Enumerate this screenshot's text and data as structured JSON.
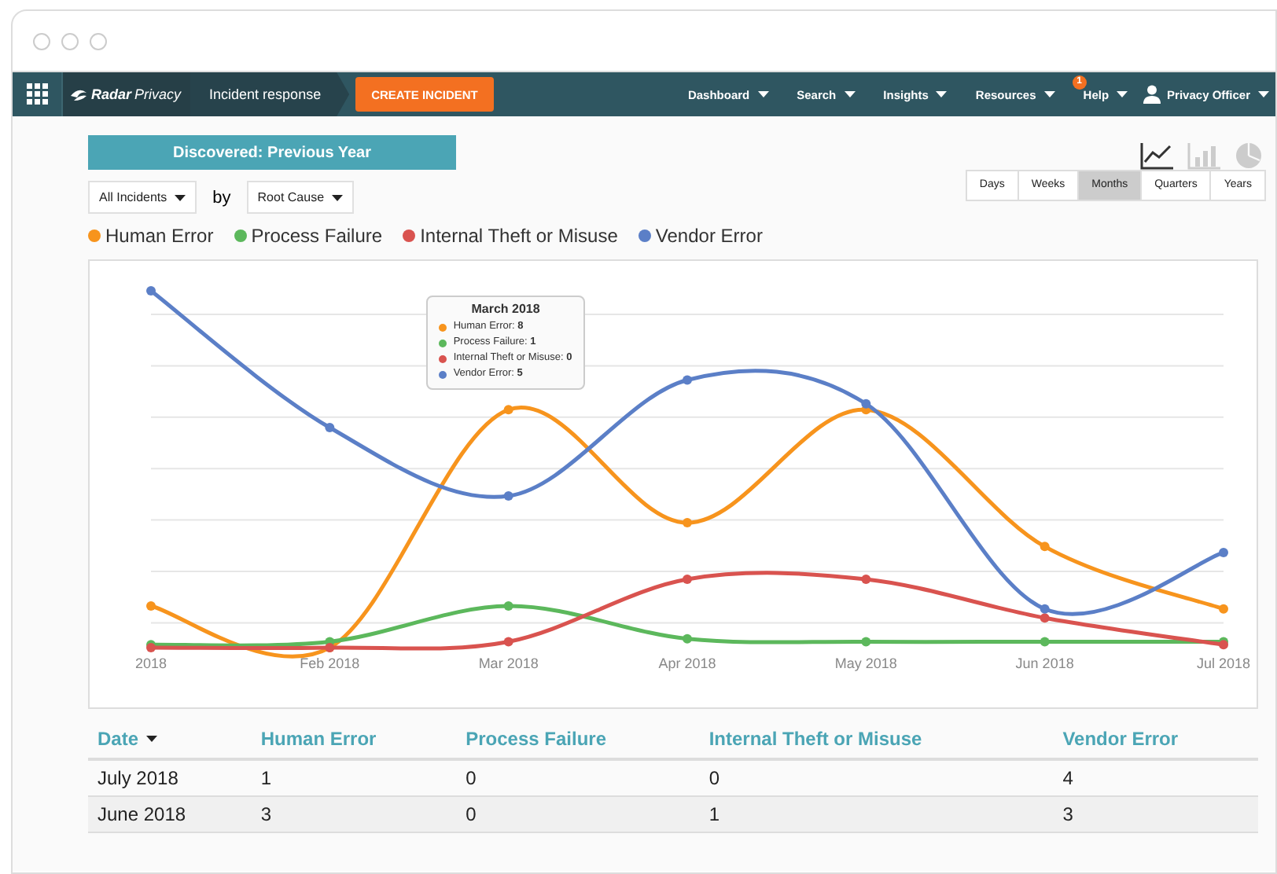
{
  "navbar": {
    "brand": [
      "Radar",
      "Privacy"
    ],
    "breadcrumb": "Incident response",
    "create_button": "CREATE INCIDENT",
    "menu": [
      {
        "label": "Dashboard"
      },
      {
        "label": "Search"
      },
      {
        "label": "Insights"
      },
      {
        "label": "Resources"
      },
      {
        "label": "Help",
        "badge": "1"
      }
    ],
    "user": "Privacy Officer"
  },
  "report": {
    "title": "Discovered: Previous Year",
    "filter": "All Incidents",
    "by": "by",
    "group": "Root Cause",
    "views": [
      {
        "kind": "line",
        "selected": true
      },
      {
        "kind": "bar",
        "selected": false
      },
      {
        "kind": "pie",
        "selected": false
      }
    ],
    "ranges": [
      {
        "label": "Days",
        "selected": false
      },
      {
        "label": "Weeks",
        "selected": false
      },
      {
        "label": "Months",
        "selected": true
      },
      {
        "label": "Quarters",
        "selected": false
      },
      {
        "label": "Years",
        "selected": false
      }
    ],
    "chart": {
      "x_labels": [
        "2018",
        "Feb 2018",
        "Mar 2018",
        "Apr 2018",
        "May 2018",
        "Jun 2018",
        "Jul 2018"
      ],
      "series": [
        {
          "name": "Human Error",
          "color": "#f7941d"
        },
        {
          "name": "Process Failure",
          "color": "#5cb85c"
        },
        {
          "name": "Internal Theft or Misuse",
          "color": "#d9534f"
        },
        {
          "name": "Vendor Error",
          "color": "#5b7fc7"
        }
      ]
    },
    "tooltip": {
      "title": "March 2018",
      "rows": [
        {
          "label": "Human Error:",
          "value": "8",
          "color": "#f7941d"
        },
        {
          "label": "Process Failure:",
          "value": "1",
          "color": "#5cb85c"
        },
        {
          "label": "Internal Theft or Misuse:",
          "value": "0",
          "color": "#d9534f"
        },
        {
          "label": "Vendor Error:",
          "value": "5",
          "color": "#5b7fc7"
        }
      ]
    }
  },
  "table": {
    "columns": [
      {
        "label": "Date",
        "sorted": true
      },
      {
        "label": "Human Error",
        "sorted": false
      },
      {
        "label": "Process Failure",
        "sorted": false
      },
      {
        "label": "Internal Theft or Misuse",
        "sorted": false
      },
      {
        "label": "Vendor Error",
        "sorted": false
      }
    ],
    "rows": [
      [
        "July 2018",
        "1",
        "0",
        "0",
        "4"
      ],
      [
        "June 2018",
        "3",
        "0",
        "1",
        "3"
      ]
    ]
  }
}
